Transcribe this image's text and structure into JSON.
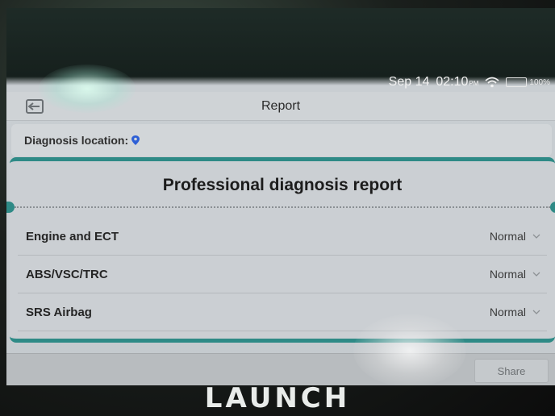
{
  "status_bar": {
    "date": "Sep 14",
    "time": "02:10",
    "ampm": "PM",
    "battery": "100%",
    "battery_level": 1.0
  },
  "header": {
    "title": "Report",
    "back_icon": "back-arrow-icon"
  },
  "location": {
    "label": "Diagnosis location:",
    "icon": "location-pin-icon"
  },
  "report": {
    "title": "Professional diagnosis report",
    "items": [
      {
        "name": "Engine and ECT",
        "status": "Normal"
      },
      {
        "name": "ABS/VSC/TRC",
        "status": "Normal"
      },
      {
        "name": "SRS Airbag",
        "status": "Normal"
      }
    ]
  },
  "footer": {
    "share_label": "Share"
  },
  "device": {
    "logo": "LAUNCH"
  },
  "colors": {
    "accent": "#2e8a86",
    "battery": "#36c23a",
    "pin": "#2d5fd6"
  }
}
